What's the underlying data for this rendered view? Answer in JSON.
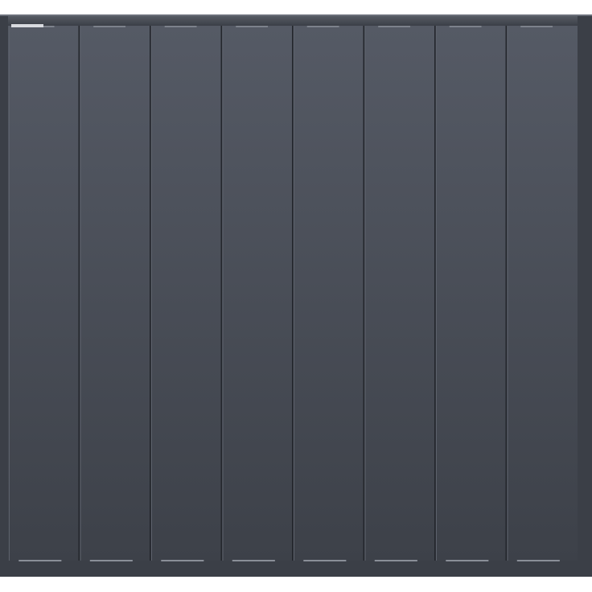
{
  "image": {
    "subject": "fence-panel",
    "board_count": 8,
    "colors": {
      "background": "#ffffff",
      "frame": "#3b3f47",
      "frame_highlight": "#5a5f68",
      "board_top": "#555a65",
      "board_bottom": "#3d4149",
      "board_seam": "#23262c",
      "board_edge_light": "#5c616b",
      "rail_clip": "#d9dbe0"
    }
  }
}
